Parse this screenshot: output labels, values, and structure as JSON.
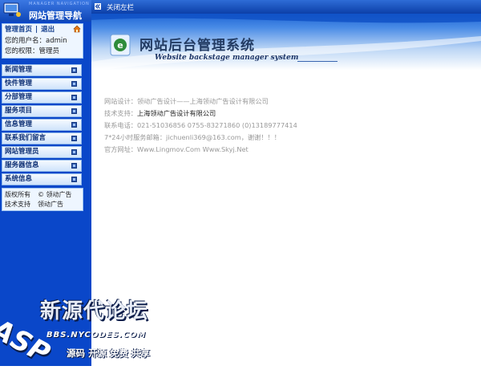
{
  "header": {
    "logo_small_text": "MANAGER NAVIGATION",
    "logo_title": "网站管理导航"
  },
  "user_panel": {
    "home_link": "管理首页",
    "logout_link": "退出",
    "username_label": "您的用户名：",
    "username_value": "admin",
    "permission_label": "您的权限：",
    "permission_value": "管理员"
  },
  "menu": {
    "items": [
      {
        "label": "新闻管理"
      },
      {
        "label": "快件管理"
      },
      {
        "label": "分部管理"
      },
      {
        "label": "服务项目"
      },
      {
        "label": "信息管理"
      },
      {
        "label": "联系我们留言"
      },
      {
        "label": "网站管理员"
      },
      {
        "label": "服务器信息"
      },
      {
        "label": "系统信息"
      }
    ]
  },
  "footer": {
    "copyright_label": "版权所有",
    "copyright_value": "© 领动广告",
    "support_label": "技术支持",
    "support_value": "领动广告"
  },
  "topbar": {
    "collapse_label": "关闭左栏"
  },
  "banner": {
    "title": "网站后台管理系统",
    "subtitle": "Website backstage manager system"
  },
  "info": {
    "design_label": "网站设计：",
    "design_value": "领动广告设计——上海领动广告设计有限公司",
    "support_label": "技术支持：",
    "support_value": "上海领动广告设计有限公司",
    "phone_label": "联系电话：",
    "phone_value": "021-51036856 0755-83271860 (0)13189777414",
    "email_label": "7*24小时服务邮箱：",
    "email_value": "jichuenli369@163.com，谢谢！！！",
    "website_label": "官方网址：",
    "website_value": "Www.Lingmov.Com Www.Skyj.Net"
  },
  "watermark": {
    "title": "新源代论坛",
    "brand": "ASP",
    "url": "BBS.NYCODES.COM",
    "tags": [
      "源码",
      "开源",
      "免费",
      "共享"
    ]
  },
  "colors": {
    "sidebar_bg": "#0a47c9",
    "menu_text": "#0d2f74",
    "info_text": "#999999"
  }
}
